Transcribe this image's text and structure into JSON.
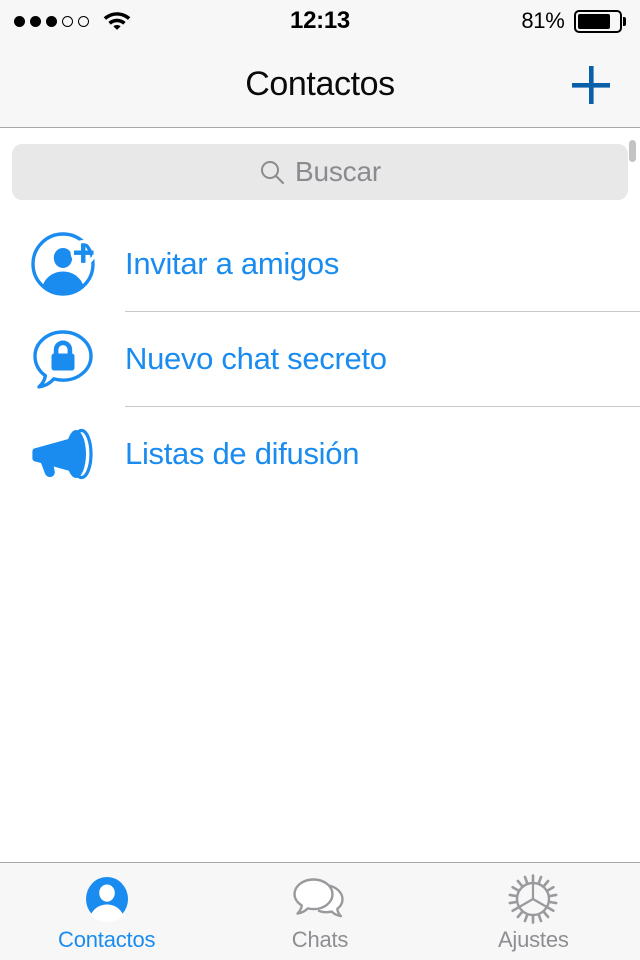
{
  "status_bar": {
    "signal_dots_total": 5,
    "signal_dots_filled": 3,
    "wifi_icon": "wifi-icon",
    "time": "12:13",
    "battery_percent_label": "81%",
    "battery_level": 81
  },
  "nav_bar": {
    "title": "Contactos",
    "add_icon": "plus-icon",
    "add_color": "#0a60a8"
  },
  "search": {
    "placeholder": "Buscar",
    "value": "",
    "icon": "search-icon"
  },
  "list": {
    "rows": [
      {
        "label": "Invitar a amigos",
        "icon": "add-person-icon"
      },
      {
        "label": "Nuevo chat secreto",
        "icon": "lock-bubble-icon"
      },
      {
        "label": "Listas de difusión",
        "icon": "megaphone-icon"
      }
    ]
  },
  "tab_bar": {
    "items": [
      {
        "label": "Contactos",
        "icon": "person-filled-icon",
        "active": true
      },
      {
        "label": "Chats",
        "icon": "chat-bubbles-icon",
        "active": false
      },
      {
        "label": "Ajustes",
        "icon": "gear-icon",
        "active": false
      }
    ]
  },
  "colors": {
    "accent_blue": "#1a8cf0",
    "nav_blue": "#0a60a8",
    "inactive_grey": "#8e8e93",
    "bar_background": "#f7f7f7",
    "separator": "#c8c7cc"
  }
}
